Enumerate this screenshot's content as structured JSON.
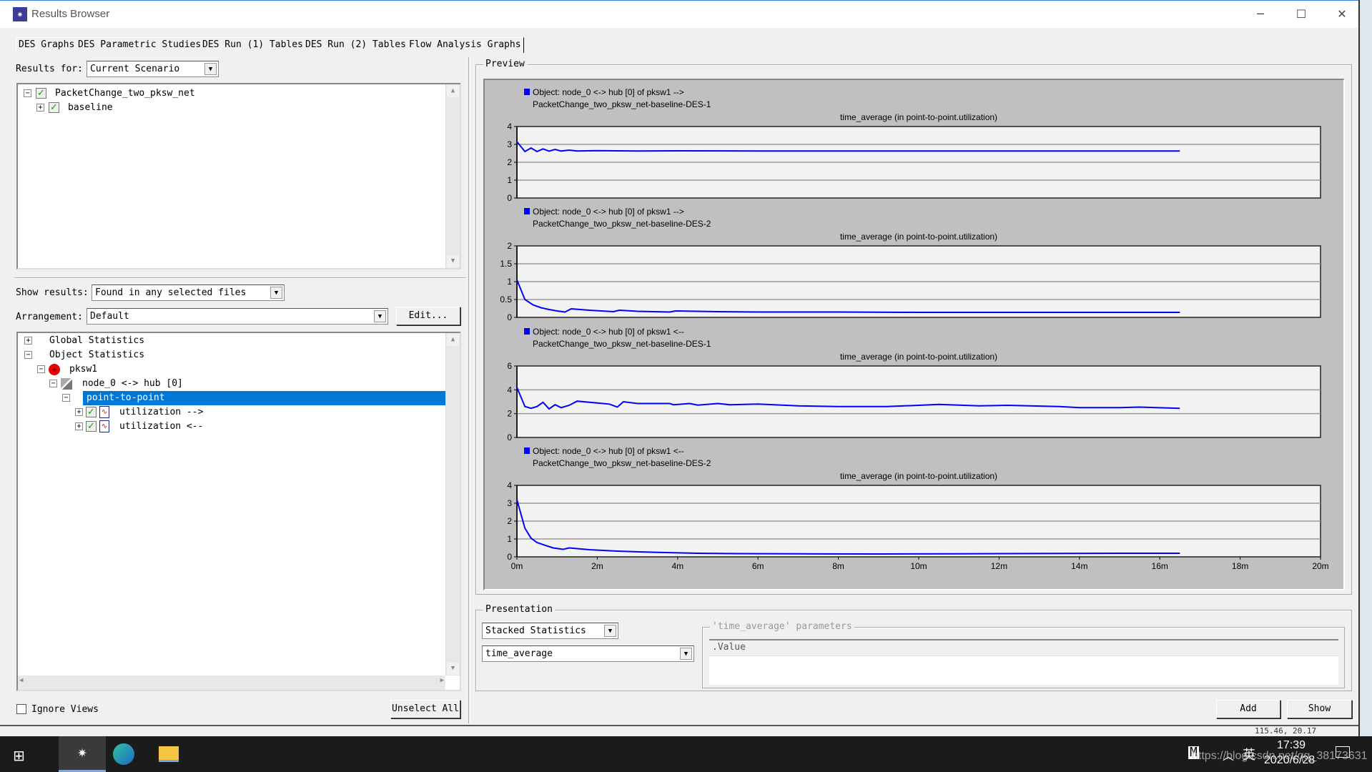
{
  "window": {
    "title": "Results Browser",
    "controls": [
      "minimize",
      "maximize",
      "close"
    ]
  },
  "tabs": [
    {
      "label": "DES Graphs",
      "active": true
    },
    {
      "label": "DES Parametric Studies"
    },
    {
      "label": "DES Run (1) Tables"
    },
    {
      "label": "DES Run (2) Tables"
    },
    {
      "label": "Flow Analysis Graphs"
    }
  ],
  "left": {
    "results_for_label": "Results for:",
    "results_for_value": "Current Scenario",
    "files_tree": [
      {
        "label": "PacketChange_two_pksw_net",
        "checked": true,
        "expanded": true
      },
      {
        "label": "baseline",
        "checked": true,
        "expanded": false
      }
    ],
    "show_results_label": "Show results:",
    "show_results_value": "Found in any selected files",
    "arrangement_label": "Arrangement:",
    "arrangement_value": "Default",
    "edit_button": "Edit...",
    "stats_tree": [
      {
        "label": "Global Statistics",
        "expanded": false
      },
      {
        "label": "Object Statistics",
        "expanded": true
      },
      {
        "label": "pksw1",
        "expanded": true,
        "icon": "switch-node-icon"
      },
      {
        "label": "node_0 <-> hub [0]",
        "expanded": true,
        "icon": "link-icon"
      },
      {
        "label": "point-to-point",
        "expanded": true,
        "selected": true
      },
      {
        "label": "utilization -->",
        "checked": true,
        "icon": "statistic-graph-icon"
      },
      {
        "label": "utilization <--",
        "checked": true,
        "icon": "statistic-graph-icon"
      }
    ],
    "ignore_views_label": "Ignore Views",
    "ignore_views_checked": false,
    "unselect_all_button": "Unselect All"
  },
  "preview": {
    "caption": "Preview"
  },
  "chart_data": [
    {
      "type": "line",
      "legend": [
        "Object: node_0 <-> hub [0] of pksw1 -->",
        "PacketChange_two_pksw_net-baseline-DES-1"
      ],
      "title": "time_average (in point-to-point.utilization)",
      "ylim": [
        0,
        4
      ],
      "yticks": [
        "0",
        "1",
        "2",
        "3",
        "4"
      ],
      "xlim": [
        0,
        20
      ],
      "grid": true,
      "color": "#0000ff",
      "x": [
        0,
        0.2,
        0.35,
        0.5,
        0.65,
        0.8,
        0.95,
        1.1,
        1.3,
        1.5,
        2,
        3,
        4,
        6,
        8,
        10,
        12,
        14,
        16.5
      ],
      "y": [
        3.15,
        2.6,
        2.8,
        2.6,
        2.75,
        2.62,
        2.72,
        2.63,
        2.68,
        2.63,
        2.65,
        2.63,
        2.64,
        2.63,
        2.63,
        2.63,
        2.63,
        2.63,
        2.63
      ]
    },
    {
      "type": "line",
      "legend": [
        "Object: node_0 <-> hub [0] of pksw1 -->",
        "PacketChange_two_pksw_net-baseline-DES-2"
      ],
      "title": "time_average (in point-to-point.utilization)",
      "ylim": [
        0,
        2
      ],
      "yticks": [
        "0",
        "0.5",
        "1",
        "1.5",
        "2"
      ],
      "xlim": [
        0,
        20
      ],
      "grid": true,
      "color": "#0000ff",
      "x": [
        0,
        0.2,
        0.4,
        0.6,
        0.8,
        1.0,
        1.2,
        1.35,
        1.8,
        2.4,
        2.55,
        3,
        3.8,
        3.95,
        5,
        6,
        8,
        10,
        12,
        14,
        16.5
      ],
      "y": [
        1.05,
        0.5,
        0.35,
        0.27,
        0.22,
        0.18,
        0.15,
        0.24,
        0.2,
        0.16,
        0.2,
        0.17,
        0.15,
        0.18,
        0.16,
        0.15,
        0.15,
        0.14,
        0.14,
        0.14,
        0.14
      ]
    },
    {
      "type": "line",
      "legend": [
        "Object: node_0 <-> hub [0] of pksw1 <--",
        "PacketChange_two_pksw_net-baseline-DES-1"
      ],
      "title": "time_average (in point-to-point.utilization)",
      "ylim": [
        0,
        6
      ],
      "yticks": [
        "0",
        "2",
        "4",
        "6"
      ],
      "xlim": [
        0,
        20
      ],
      "grid": true,
      "color": "#0000ff",
      "x": [
        0,
        0.2,
        0.35,
        0.5,
        0.65,
        0.8,
        0.95,
        1.1,
        1.3,
        1.5,
        2,
        2.3,
        2.5,
        2.65,
        3,
        3.8,
        3.9,
        4.3,
        4.5,
        5,
        5.3,
        6,
        7,
        8,
        9.2,
        10,
        10.5,
        11.5,
        12.2,
        13.5,
        14,
        15,
        15.5,
        16.5
      ],
      "y": [
        4.2,
        2.6,
        2.45,
        2.6,
        2.95,
        2.4,
        2.75,
        2.5,
        2.7,
        3.05,
        2.9,
        2.8,
        2.55,
        3.0,
        2.85,
        2.85,
        2.75,
        2.85,
        2.72,
        2.85,
        2.75,
        2.8,
        2.65,
        2.6,
        2.6,
        2.7,
        2.78,
        2.65,
        2.7,
        2.6,
        2.5,
        2.5,
        2.55,
        2.45
      ]
    },
    {
      "type": "line",
      "legend": [
        "Object: node_0 <-> hub [0] of pksw1 <--",
        "PacketChange_two_pksw_net-baseline-DES-2"
      ],
      "title": "time_average (in point-to-point.utilization)",
      "ylim": [
        0,
        4
      ],
      "yticks": [
        "0",
        "1",
        "2",
        "3",
        "4"
      ],
      "xlim": [
        0,
        20
      ],
      "grid": true,
      "color": "#0000ff",
      "xticks": [
        "0m",
        "2m",
        "4m",
        "6m",
        "8m",
        "10m",
        "12m",
        "14m",
        "16m",
        "18m",
        "20m"
      ],
      "x": [
        0,
        0.2,
        0.35,
        0.5,
        0.7,
        0.9,
        1.15,
        1.3,
        1.8,
        2.5,
        3.5,
        4.5,
        5.5,
        7,
        9,
        11,
        12,
        15,
        16.5
      ],
      "y": [
        3.2,
        1.6,
        1.05,
        0.8,
        0.65,
        0.5,
        0.42,
        0.5,
        0.4,
        0.32,
        0.25,
        0.2,
        0.18,
        0.17,
        0.16,
        0.17,
        0.18,
        0.2,
        0.2
      ]
    }
  ],
  "presentation": {
    "caption": "Presentation",
    "mode_value": "Stacked Statistics",
    "filter_value": "time_average",
    "params_caption": "'time_average' parameters",
    "params_column": "Value",
    "add_button": "Add",
    "show_button": "Show"
  },
  "statusbar": {
    "coords": "115.46, 20.17"
  },
  "taskbar": {
    "time": "17:39",
    "date": "2020/6/28",
    "ime": "英",
    "watermark": "https://blog.csdn.net/qq_38173631"
  }
}
